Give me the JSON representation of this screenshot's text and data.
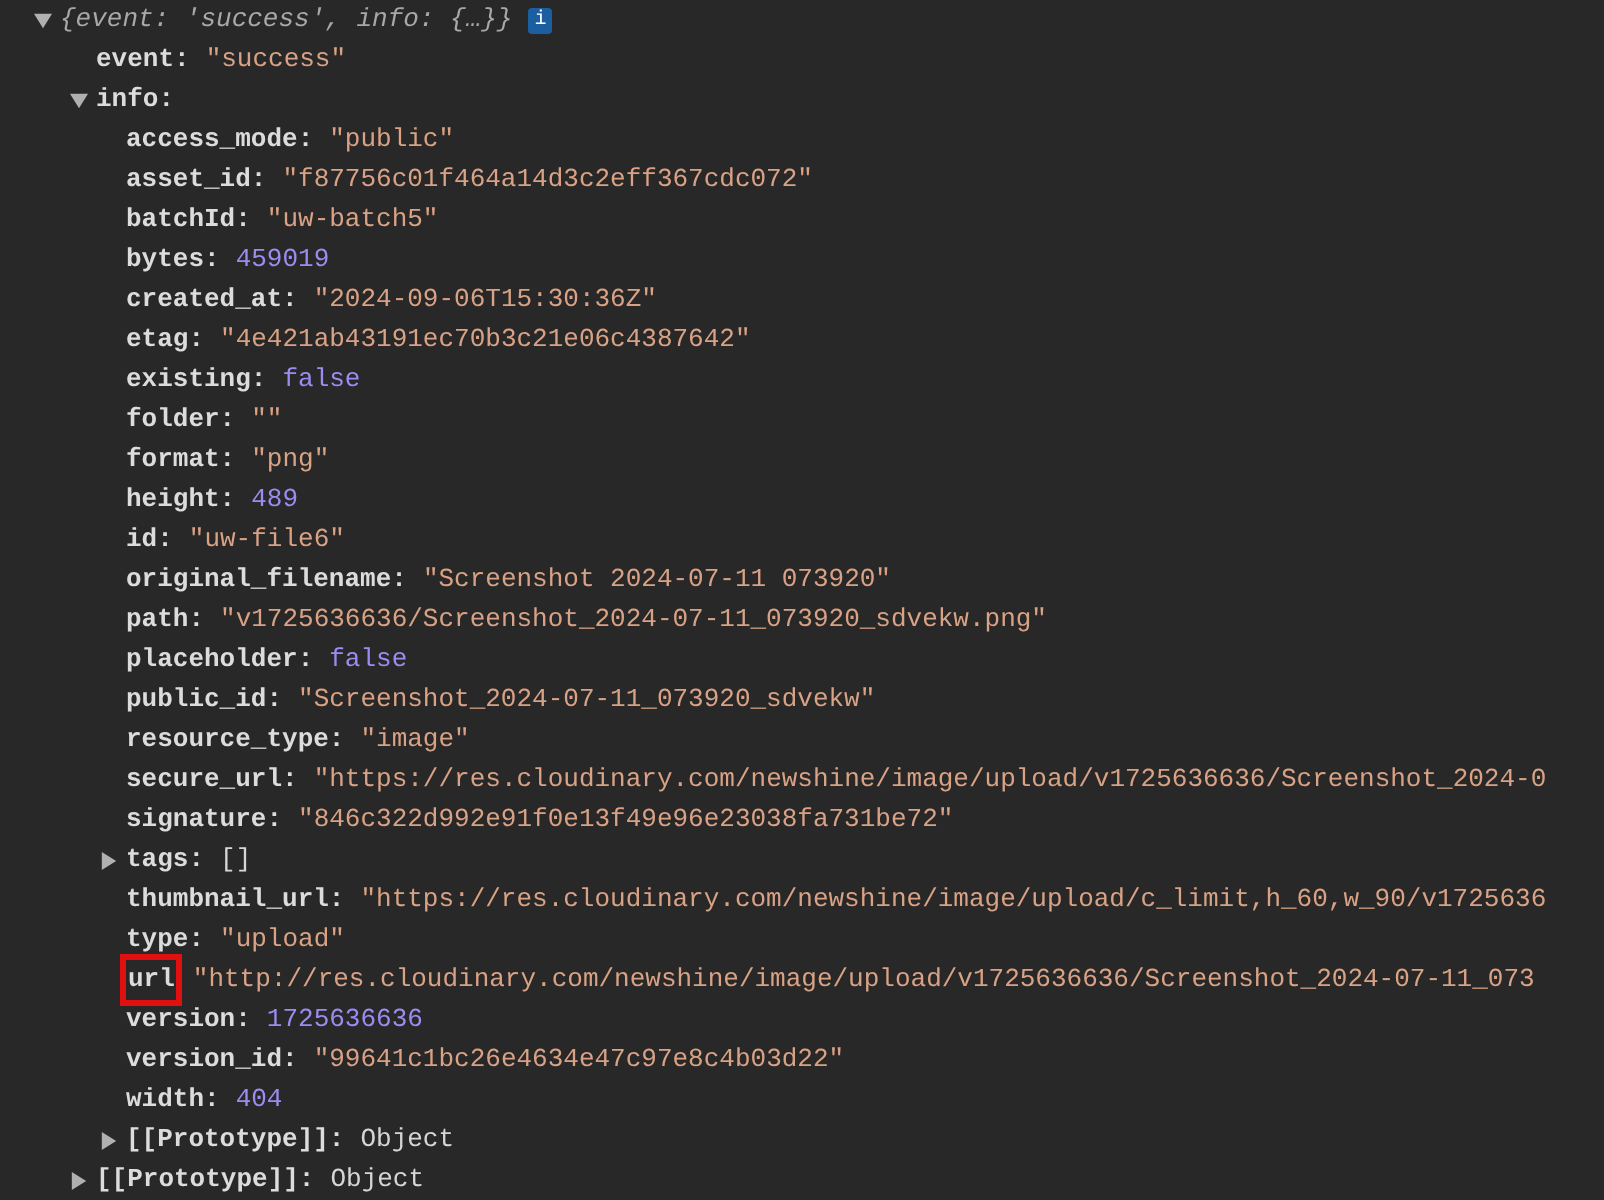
{
  "root": {
    "summary": "{event: 'success', info: {…}}",
    "info_badge": "i",
    "expanded": true,
    "children": [
      {
        "key": "event:",
        "value": "\"success\"",
        "kind": "string"
      },
      {
        "key": "info:",
        "expanded": true,
        "children": [
          {
            "key": "access_mode:",
            "value": "\"public\"",
            "kind": "string"
          },
          {
            "key": "asset_id:",
            "value": "\"f87756c01f464a14d3c2eff367cdc072\"",
            "kind": "string"
          },
          {
            "key": "batchId:",
            "value": "\"uw-batch5\"",
            "kind": "string"
          },
          {
            "key": "bytes:",
            "value": "459019",
            "kind": "number"
          },
          {
            "key": "created_at:",
            "value": "\"2024-09-06T15:30:36Z\"",
            "kind": "string"
          },
          {
            "key": "etag:",
            "value": "\"4e421ab43191ec70b3c21e06c4387642\"",
            "kind": "string"
          },
          {
            "key": "existing:",
            "value": "false",
            "kind": "boolean"
          },
          {
            "key": "folder:",
            "value": "\"\"",
            "kind": "string"
          },
          {
            "key": "format:",
            "value": "\"png\"",
            "kind": "string"
          },
          {
            "key": "height:",
            "value": "489",
            "kind": "number"
          },
          {
            "key": "id:",
            "value": "\"uw-file6\"",
            "kind": "string"
          },
          {
            "key": "original_filename:",
            "value": "\"Screenshot 2024-07-11 073920\"",
            "kind": "string"
          },
          {
            "key": "path:",
            "value": "\"v1725636636/Screenshot_2024-07-11_073920_sdvekw.png\"",
            "kind": "string"
          },
          {
            "key": "placeholder:",
            "value": "false",
            "kind": "boolean"
          },
          {
            "key": "public_id:",
            "value": "\"Screenshot_2024-07-11_073920_sdvekw\"",
            "kind": "string"
          },
          {
            "key": "resource_type:",
            "value": "\"image\"",
            "kind": "string"
          },
          {
            "key": "secure_url:",
            "value": "\"https://res.cloudinary.com/newshine/image/upload/v1725636636/Screenshot_2024-0",
            "kind": "string"
          },
          {
            "key": "signature:",
            "value": "\"846c322d992e91f0e13f49e96e23038fa731be72\"",
            "kind": "string"
          },
          {
            "key": "tags:",
            "value": "[]",
            "kind": "object",
            "expanded": false
          },
          {
            "key": "thumbnail_url:",
            "value": "\"https://res.cloudinary.com/newshine/image/upload/c_limit,h_60,w_90/v1725636",
            "kind": "string"
          },
          {
            "key": "type:",
            "value": "\"upload\"",
            "kind": "string"
          },
          {
            "key": "url",
            "value": "\"http://res.cloudinary.com/newshine/image/upload/v1725636636/Screenshot_2024-07-11_073",
            "kind": "string",
            "highlighted": true
          },
          {
            "key": "version:",
            "value": "1725636636",
            "kind": "number"
          },
          {
            "key": "version_id:",
            "value": "\"99641c1bc26e4634e47c97e8c4b03d22\"",
            "kind": "string"
          },
          {
            "key": "width:",
            "value": "404",
            "kind": "number"
          },
          {
            "key": "[[Prototype]]:",
            "value": "Object",
            "kind": "object",
            "expanded": false
          }
        ]
      },
      {
        "key": "[[Prototype]]:",
        "value": "Object",
        "kind": "object",
        "expanded": false
      }
    ]
  }
}
